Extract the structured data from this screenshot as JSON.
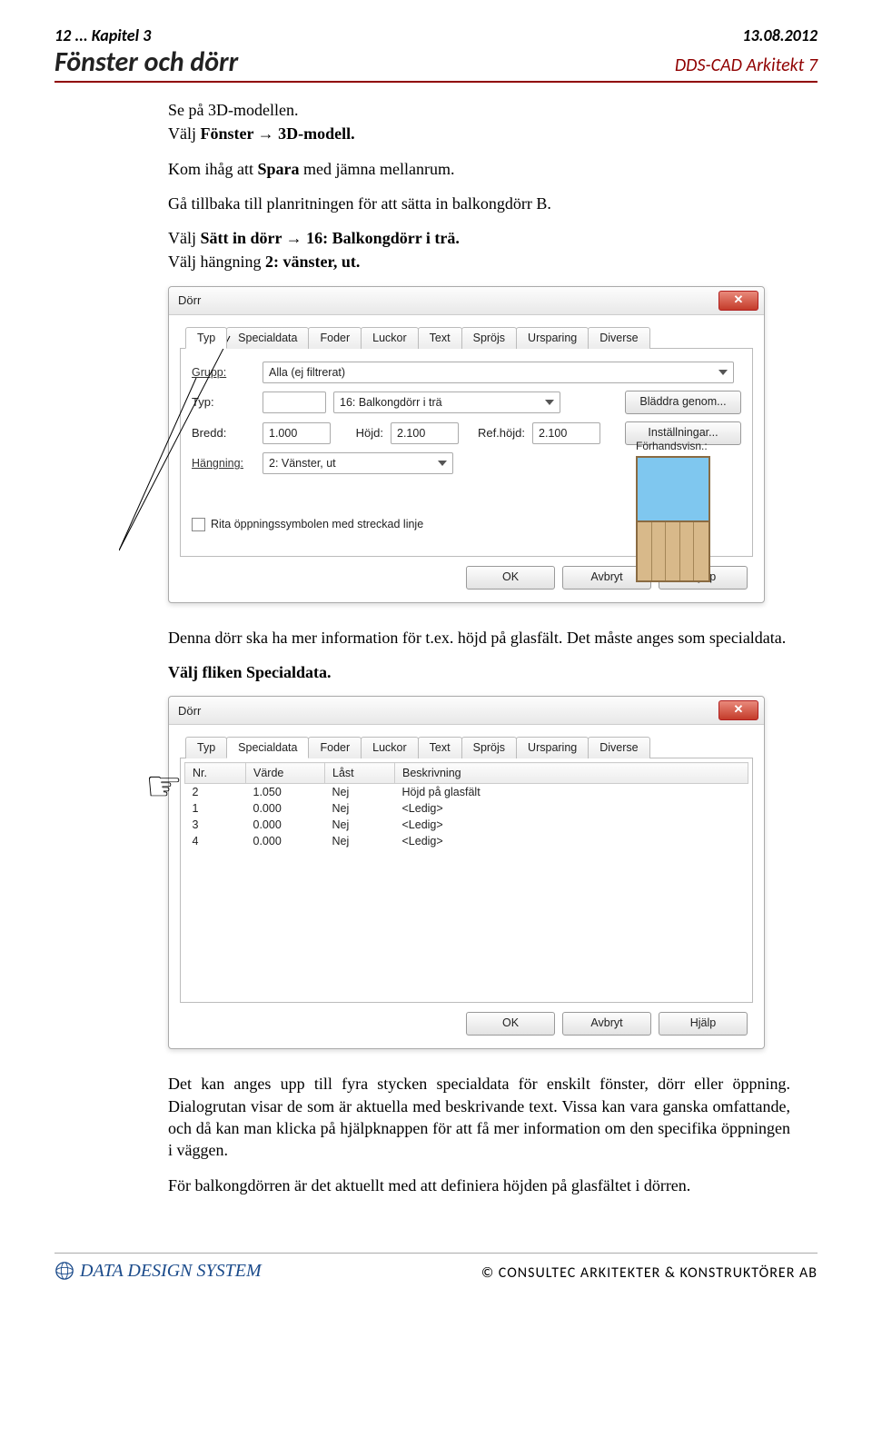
{
  "header": {
    "chapter": "12 ... Kapitel 3",
    "date": "13.08.2012",
    "title": "Fönster och dörr",
    "app": "DDS-CAD Arkitekt 7"
  },
  "intro": {
    "l1": "Se på 3D-modellen.",
    "l2a": "Välj",
    "l2b": "Fönster → 3D-modell.",
    "l3a": "Kom ihåg att",
    "l3b": "Spara",
    "l3c": "med jämna mellanrum.",
    "l4": "Gå tillbaka till planritningen för att sätta in balkongdörr B.",
    "l5a": "Välj",
    "l5b": "Sätt in dörr → 16: Balkongdörr i trä.",
    "l6a": "Välj hängning",
    "l6b": "2: vänster, ut."
  },
  "dlg1": {
    "title": "Dörr",
    "tabs": [
      "Typ",
      "Specialdata",
      "Foder",
      "Luckor",
      "Text",
      "Spröjs",
      "Ursparing",
      "Diverse"
    ],
    "activeTab": 0,
    "labels": {
      "grupp": "Grupp:",
      "typ": "Typ:",
      "bredd": "Bredd:",
      "hojd": "Höjd:",
      "refhojd": "Ref.höjd:",
      "hangning": "Hängning:",
      "forhands": "Förhandsvisn.:"
    },
    "values": {
      "grupp": "Alla (ej filtrerat)",
      "typ_code": "",
      "typ": "16: Balkongdörr i trä",
      "bredd": "1.000",
      "hojd": "2.100",
      "refhojd": "2.100",
      "hangning": "2: Vänster, ut"
    },
    "buttons": {
      "browse": "Bläddra genom...",
      "settings": "Inställningar...",
      "ok": "OK",
      "cancel": "Avbryt",
      "help": "Hjälp"
    },
    "checkbox": "Rita öppningssymbolen med streckad linje"
  },
  "mid": {
    "p1": "Denna dörr ska ha mer information för t.ex. höjd på glasfält. Det måste anges som specialdata.",
    "p2": "Välj fliken Specialdata."
  },
  "dlg2": {
    "title": "Dörr",
    "tabs": [
      "Typ",
      "Specialdata",
      "Foder",
      "Luckor",
      "Text",
      "Spröjs",
      "Ursparing",
      "Diverse"
    ],
    "activeTab": 1,
    "cols": [
      "Nr.",
      "Värde",
      "Låst",
      "Beskrivning"
    ],
    "rows": [
      {
        "nr": "2",
        "varde": "1.050",
        "last": "Nej",
        "besk": "Höjd på glasfält"
      },
      {
        "nr": "1",
        "varde": "0.000",
        "last": "Nej",
        "besk": "<Ledig>"
      },
      {
        "nr": "3",
        "varde": "0.000",
        "last": "Nej",
        "besk": "<Ledig>"
      },
      {
        "nr": "4",
        "varde": "0.000",
        "last": "Nej",
        "besk": "<Ledig>"
      }
    ],
    "buttons": {
      "ok": "OK",
      "cancel": "Avbryt",
      "help": "Hjälp"
    }
  },
  "outro": {
    "p1": "Det kan anges upp till fyra stycken specialdata för enskilt fönster, dörr eller öppning. Dialogrutan visar de som är aktuella med beskrivande text. Vissa kan vara ganska omfattande, och då kan man klicka på hjälpknappen för att få mer information om den specifika öppningen i väggen.",
    "p2": "För balkongdörren är det aktuellt med att definiera höjden på glasfältet i dörren."
  },
  "footer": {
    "logo": "DATA DESIGN SYSTEM",
    "copyright": "©  CONSULTEC ARKITEKTER & KONSTRUKTÖRER AB"
  }
}
